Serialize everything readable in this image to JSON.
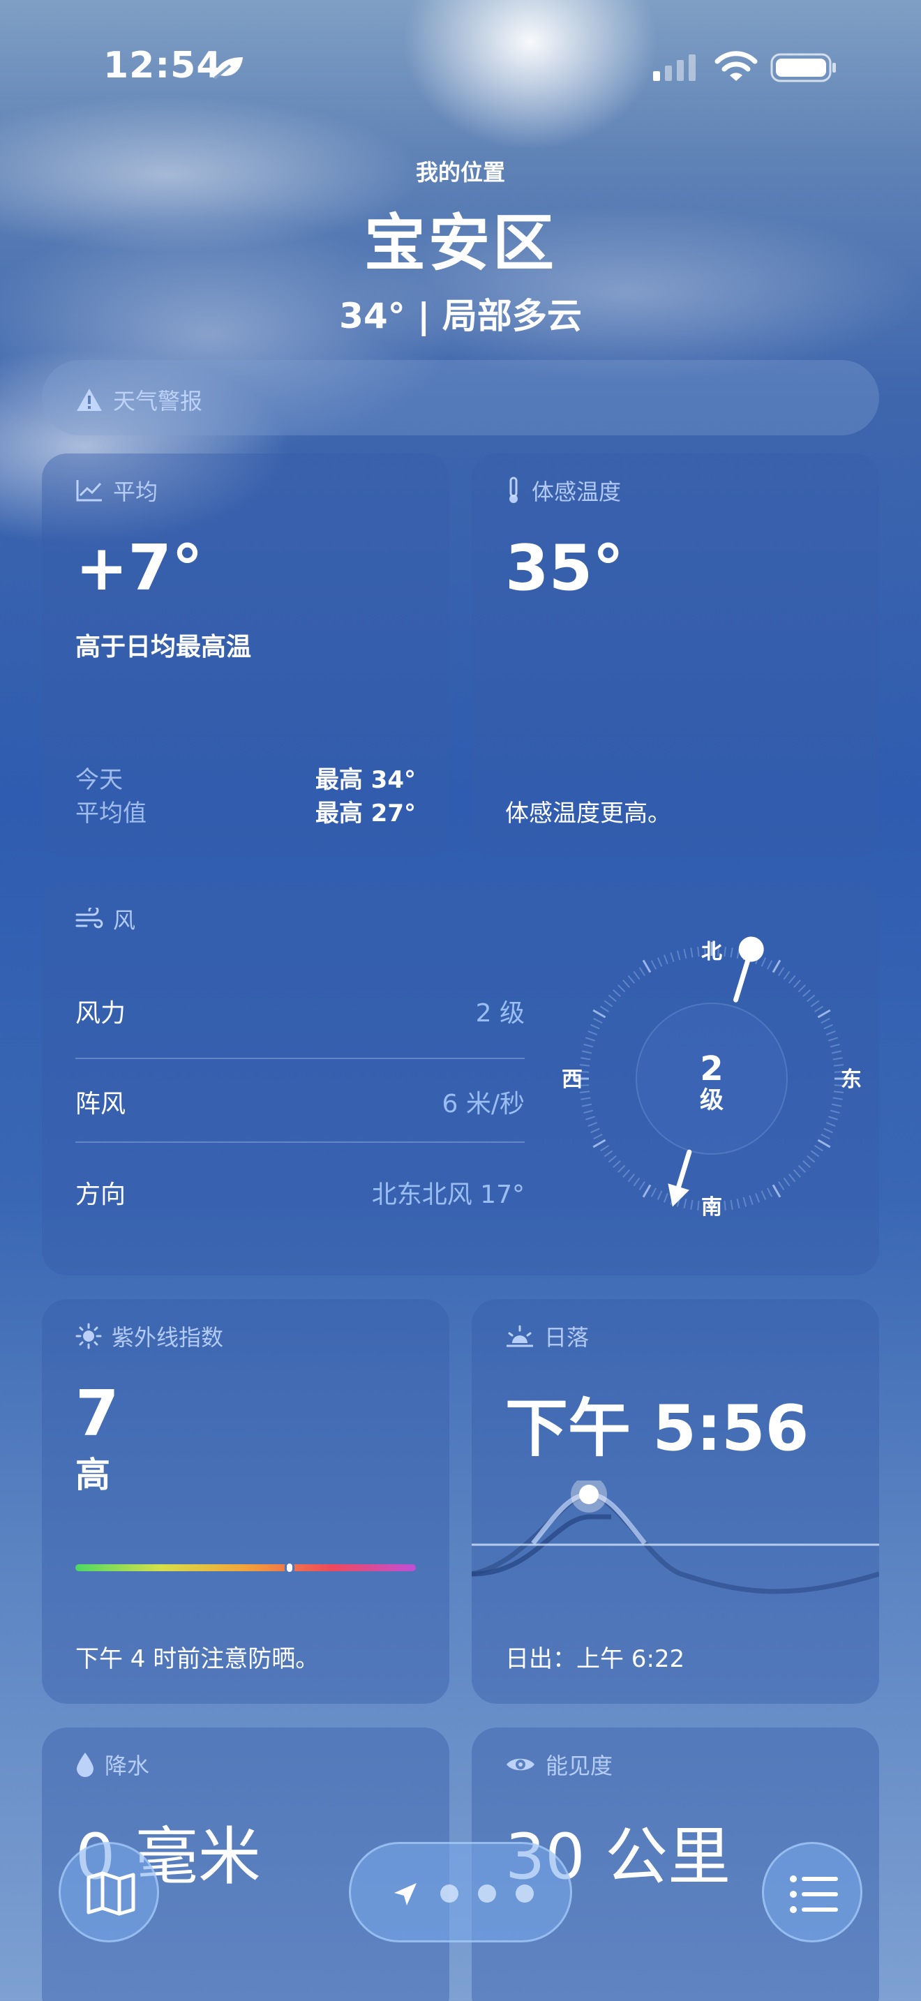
{
  "status_bar": {
    "time": "12:54"
  },
  "location": {
    "label": "我的位置",
    "city": "宝安区",
    "summary": "34° | 局部多云"
  },
  "alert": {
    "title": "天气警报"
  },
  "average": {
    "title": "平均",
    "value": "+7°",
    "description": "高于日均最高温",
    "today_label": "今天",
    "today_value": "最高 34°",
    "avg_label": "平均值",
    "avg_value": "最高 27°"
  },
  "feels_like": {
    "title": "体感温度",
    "value": "35°",
    "note": "体感温度更高。"
  },
  "wind": {
    "title": "风",
    "rows": [
      {
        "label": "风力",
        "value": "2 级"
      },
      {
        "label": "阵风",
        "value": "6 米/秒"
      },
      {
        "label": "方向",
        "value": "北东北风 17°"
      }
    ],
    "compass": {
      "north": "北",
      "south": "南",
      "west": "西",
      "east": "东",
      "level": "2",
      "unit": "级",
      "direction_deg": 17
    }
  },
  "uv": {
    "title": "紫外线指数",
    "value": "7",
    "level": "高",
    "scale_position": 0.63,
    "note": "下午 4 时前注意防晒。"
  },
  "sunset": {
    "title": "日落",
    "value": "下午 5:56",
    "sunrise": "日出：上午 6:22"
  },
  "precipitation": {
    "title": "降水",
    "value": "0 毫米"
  },
  "visibility": {
    "title": "能见度",
    "value": "30 公里"
  },
  "dock": {
    "map_icon": "map-icon",
    "location_icon": "location-arrow-icon",
    "list_icon": "list-icon"
  },
  "colors": {
    "card": "#365caa",
    "accent_text": "#a0c3f5"
  }
}
